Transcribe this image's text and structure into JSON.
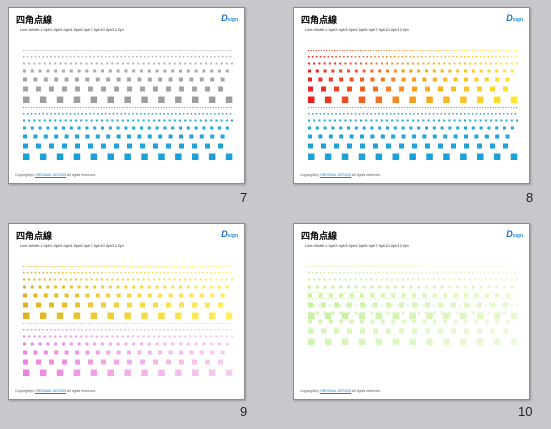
{
  "slides": [
    {
      "number": "7",
      "title": "四角点線",
      "subtitle": "Line-Width:1.0pt/2.0pt/3.0pt/4.5pt/6.0pt/7.5pt/10.0pt/12.0pt",
      "logo": "D",
      "logo_suffix": "sign",
      "copyright_prefix": "Copyright(c) ",
      "copyright_link": "ORIGINAL DESIGN",
      "copyright_suffix": " All rights reserved.",
      "top_colors": [
        "#b4b4b4",
        "#b4b4b4",
        "#b4b4b4",
        "#aaaaaa",
        "#a6a6a6",
        "#a2a2a2",
        "#9e9e9e"
      ],
      "bottom_colors": [
        "#24a8e0",
        "#24a8e0",
        "#24a8e0",
        "#22a6de",
        "#20a4dc",
        "#1ea2da",
        "#1ca0d8"
      ]
    },
    {
      "number": "8",
      "title": "四角点線",
      "subtitle": "Line-Width:1.0pt/2.0pt/3.0pt/4.5pt/6.0pt/7.5pt/10.0pt/12.0pt",
      "logo": "D",
      "logo_suffix": "sign",
      "copyright_prefix": "Copyright(c) ",
      "copyright_link": "ORIGINAL DESIGN",
      "copyright_suffix": " All rights reserved.",
      "top_gradient": [
        "#ee2020",
        "#f7a020",
        "#ffee30"
      ],
      "bottom_colors": [
        "#24a8e0",
        "#24a8e0",
        "#24a8e0",
        "#22a6de",
        "#20a4dc",
        "#1ea2da",
        "#1ca0d8"
      ]
    },
    {
      "number": "9",
      "title": "四角点線",
      "subtitle": "Line-Width:1.0pt/2.0pt/3.0pt/4.5pt/6.0pt/7.5pt/10.0pt/12.0pt",
      "logo": "D",
      "logo_suffix": "sign",
      "copyright_prefix": "Copyright(c) ",
      "copyright_link": "ORIGINAL DESIGN",
      "copyright_suffix": " All rights reserved.",
      "top_gradient": [
        "#e0b020",
        "#f4d840",
        "#fff060"
      ],
      "bottom_gradient": [
        "#f080e0",
        "#f4b0ea",
        "#f8d0f0"
      ]
    },
    {
      "number": "10",
      "title": "四角点線",
      "subtitle": "Line-Width:1.0pt/2.0pt/3.0pt/4.5pt/6.0pt/7.5pt/10.0pt/12.0pt",
      "logo": "D",
      "logo_suffix": "sign",
      "copyright_prefix": "Copyright(c) ",
      "copyright_link": "ORIGINAL DESIGN",
      "copyright_suffix": " All rights reserved.",
      "top_gradient": [
        "#c8f0a0",
        "#d8f4b8",
        "#e8f8d0"
      ],
      "bottom_gradient": []
    }
  ]
}
